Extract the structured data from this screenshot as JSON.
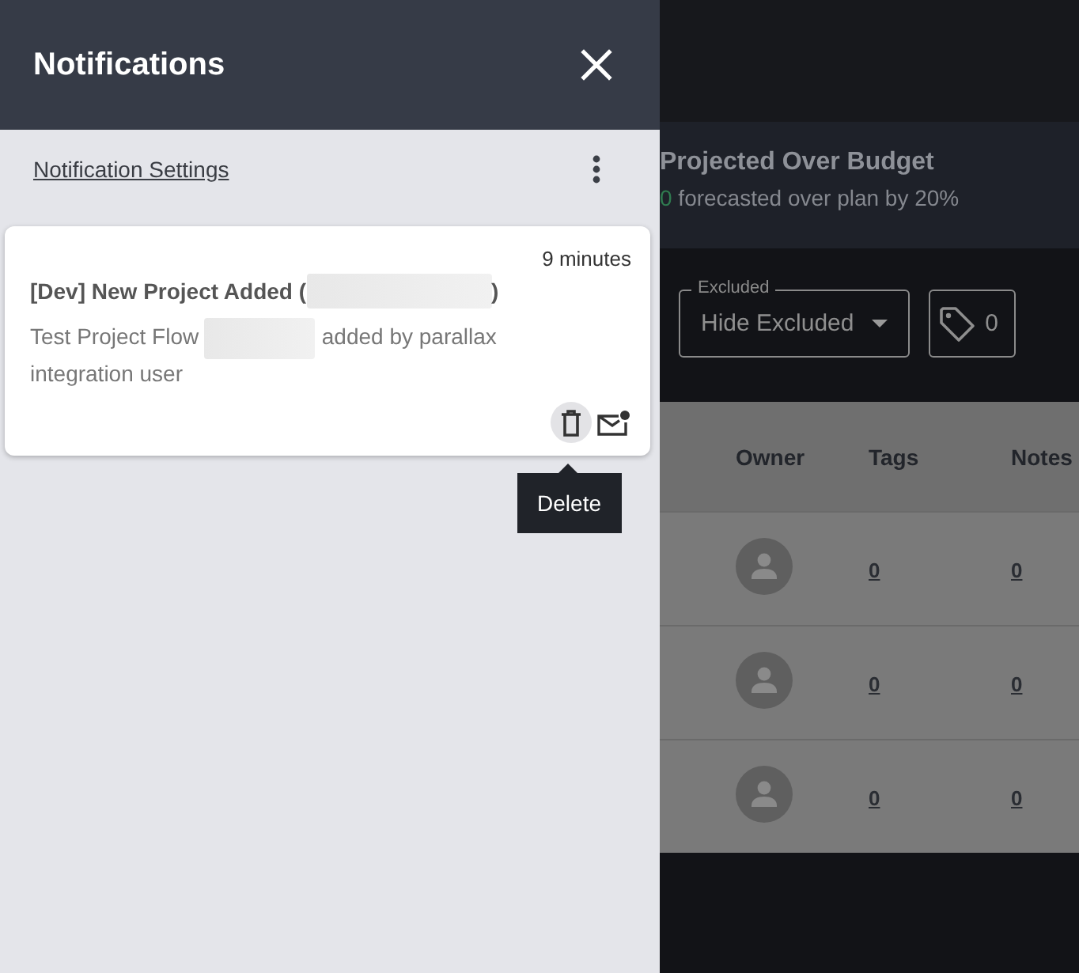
{
  "drawer": {
    "title": "Notifications",
    "settings_link": "Notification Settings",
    "notifications": [
      {
        "time": "9 minutes",
        "title_parts": [
          "[Dev] New Project Added (",
          ")"
        ],
        "message_parts": [
          "Test Project Flow",
          "added by parallax integration user"
        ],
        "unread": true,
        "tooltip": "Delete"
      }
    ]
  },
  "budget_card": {
    "title": "Projected Over Budget",
    "count": "0",
    "text": "forecasted over plan by 20%"
  },
  "filter": {
    "label": "Excluded",
    "value": "Hide Excluded"
  },
  "tag_filter": {
    "count": "0"
  },
  "table": {
    "columns": [
      "Owner",
      "Tags",
      "Notes"
    ],
    "rows": [
      {
        "tags": "0",
        "notes": "0"
      },
      {
        "tags": "0",
        "notes": "0"
      },
      {
        "tags": "0",
        "notes": "0"
      }
    ]
  }
}
